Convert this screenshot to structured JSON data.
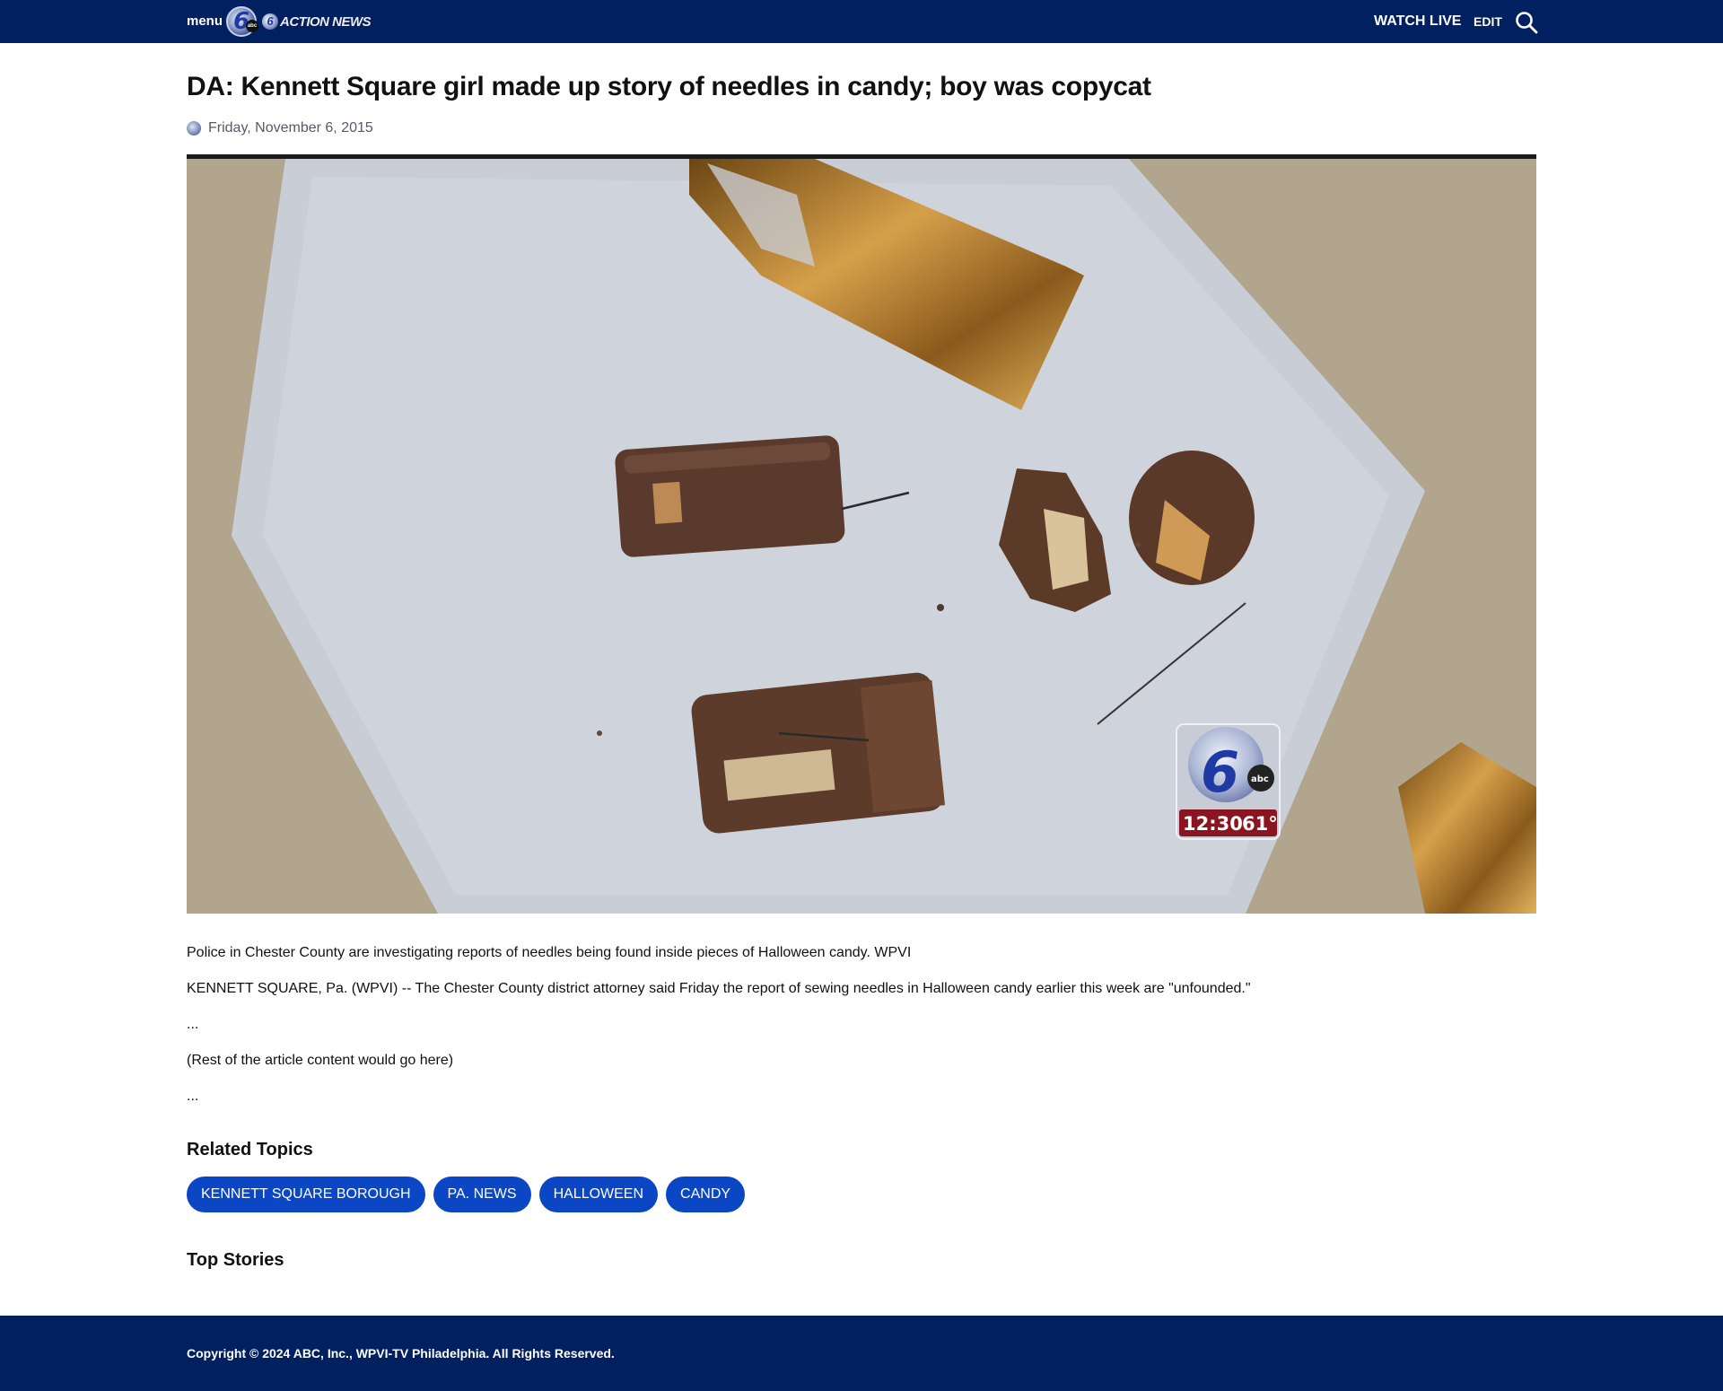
{
  "header": {
    "menu_label": "menu",
    "logo_six": "6",
    "logo_abc": "abc",
    "logo_action_news": "ACTION NEWS",
    "watch_live_label": "WATCH LIVE",
    "edit_label": "EDIT",
    "search_icon": "search-icon",
    "background_color": "#00205f"
  },
  "article": {
    "headline": "DA: Kennett Square girl made up story of needles in candy; boy was copycat",
    "date": "Friday, November 6, 2015",
    "media": {
      "bug_time": "12:30",
      "bug_temp": "61°",
      "bug_logo_six": "6",
      "bug_logo_abc": "abc"
    },
    "caption": "Police in Chester County are investigating reports of needles being found inside pieces of Halloween candy. WPVI",
    "paragraphs": [
      "KENNETT SQUARE, Pa. (WPVI) -- The Chester County district attorney said Friday the report of sewing needles in Halloween candy earlier this week are \"unfounded.\"",
      "...",
      "(Rest of the article content would go here)",
      "..."
    ]
  },
  "related": {
    "title": "Related Topics",
    "topics": [
      "KENNETT SQUARE BOROUGH",
      "PA. NEWS",
      "HALLOWEEN",
      "CANDY"
    ],
    "pill_color": "#0b47c4"
  },
  "top_stories": {
    "title": "Top Stories"
  },
  "footer": {
    "copyright": "Copyright © 2024 ABC, Inc., WPVI-TV Philadelphia. All Rights Reserved."
  }
}
